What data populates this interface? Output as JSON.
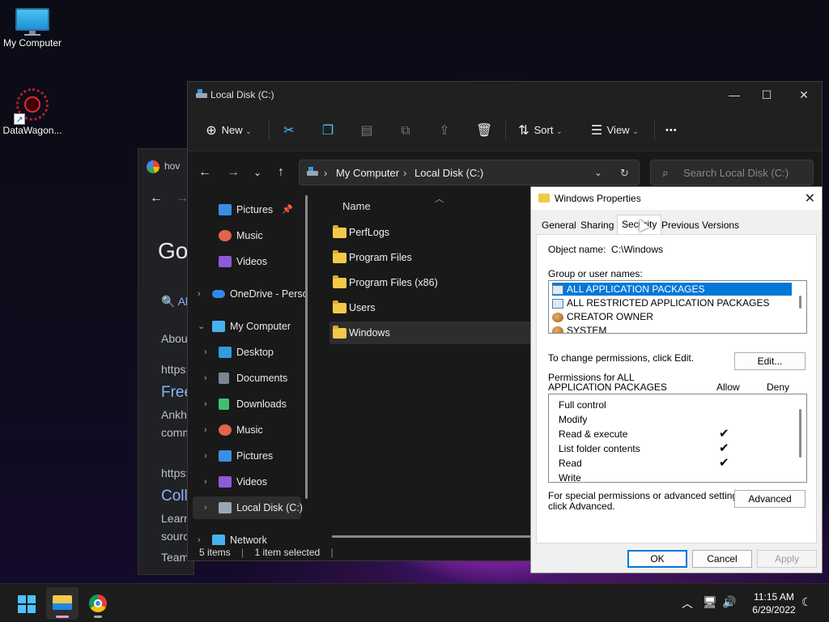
{
  "desktop": {
    "icons": [
      {
        "label": "My Computer"
      },
      {
        "label": "DataWagon..."
      }
    ]
  },
  "chrome": {
    "tab_text": "hov",
    "google_text": "Go",
    "lines": [
      "Al",
      "About",
      "https:",
      "Free",
      "Ankh",
      "comm",
      "https:",
      "Coll",
      "Learn",
      "sourc",
      "Team"
    ]
  },
  "explorer": {
    "title": "Local Disk (C:)",
    "commands": {
      "new": "New",
      "sort": "Sort",
      "view": "View",
      "more": "•••"
    },
    "address": {
      "segments": [
        "My Computer",
        "Local Disk (C:)"
      ]
    },
    "search_placeholder": "Search Local Disk (C:)",
    "nav_items": [
      {
        "label": "Pictures",
        "color": "#3a8ee6"
      },
      {
        "label": "Music",
        "color": "#e0654a"
      },
      {
        "label": "Videos",
        "color": "#8e5ad8"
      },
      {
        "label": "OneDrive - Perso",
        "color": "#2e8ae6"
      },
      {
        "label": "My Computer",
        "color": "#49b0ec"
      },
      {
        "label": "Desktop",
        "color": "#2f9de0"
      },
      {
        "label": "Documents",
        "color": "#7a8797"
      },
      {
        "label": "Downloads",
        "color": "#3fbf6f"
      },
      {
        "label": "Music",
        "color": "#e0654a"
      },
      {
        "label": "Pictures",
        "color": "#3a8ee6"
      },
      {
        "label": "Videos",
        "color": "#8e5ad8"
      },
      {
        "label": "Local Disk (C:)",
        "color": "#9aa6b2"
      },
      {
        "label": "Network",
        "color": "#49b0ec"
      }
    ],
    "column_name": "Name",
    "files": [
      "PerfLogs",
      "Program Files",
      "Program Files (x86)",
      "Users",
      "Windows"
    ],
    "status": {
      "items": "5 items",
      "selected": "1 item selected"
    }
  },
  "properties": {
    "title": "Windows Properties",
    "tabs": [
      "General",
      "Sharing",
      "Security",
      "Previous Versions"
    ],
    "object_name_label": "Object name:",
    "object_name_value": "C:\\Windows",
    "group_label": "Group or user names:",
    "groups": [
      "ALL APPLICATION PACKAGES",
      "ALL RESTRICTED APPLICATION PACKAGES",
      "CREATOR OWNER",
      "SYSTEM"
    ],
    "change_text": "To change permissions, click Edit.",
    "edit_button": "Edit...",
    "permissions_for": "Permissions for ALL APPLICATION PACKAGES",
    "perm_line1": "Permissions for ALL",
    "perm_line2": "APPLICATION PACKAGES",
    "allow": "Allow",
    "deny": "Deny",
    "permissions": [
      {
        "name": "Full control",
        "allow": false
      },
      {
        "name": "Modify",
        "allow": false
      },
      {
        "name": "Read & execute",
        "allow": true
      },
      {
        "name": "List folder contents",
        "allow": true
      },
      {
        "name": "Read",
        "allow": true
      },
      {
        "name": "Write",
        "allow": false
      }
    ],
    "special_line1": "For special permissions or advanced settings,",
    "special_line2": "click Advanced.",
    "advanced_button": "Advanced",
    "ok": "OK",
    "cancel": "Cancel",
    "apply": "Apply",
    "check_glyph": "✔"
  },
  "taskbar": {
    "time": "11:15 AM",
    "date": "6/29/2022"
  }
}
